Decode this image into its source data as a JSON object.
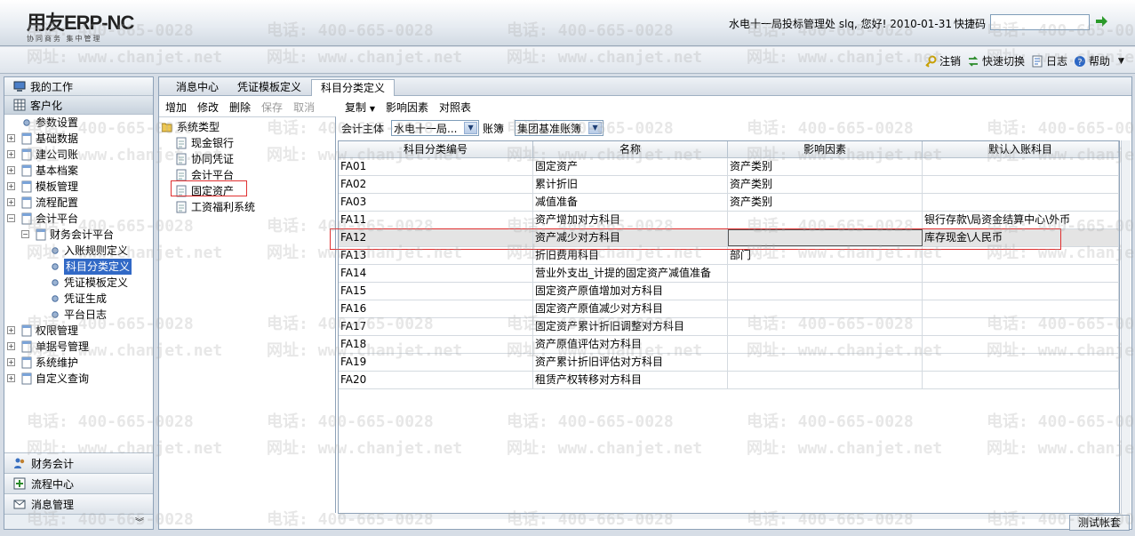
{
  "app": {
    "logo_text": "用友ERP-NC",
    "logo_sub": "协同商务 集中管理",
    "user_info": "水电十一局投标管理处 slq, 您好! 2010-01-31",
    "quick_code_label": "快捷码"
  },
  "toolbar2": {
    "logout": "注销",
    "quick_switch": "快速切换",
    "log": "日志",
    "help": "帮助"
  },
  "leftpanel": {
    "header_work": "我的工作",
    "header_custom": "客户化",
    "tree": [
      {
        "label": "参数设置",
        "level": 0,
        "expander": "none"
      },
      {
        "label": "基础数据",
        "level": 0,
        "expander": "plus"
      },
      {
        "label": "建公司账",
        "level": 0,
        "expander": "plus"
      },
      {
        "label": "基本档案",
        "level": 0,
        "expander": "plus"
      },
      {
        "label": "模板管理",
        "level": 0,
        "expander": "plus"
      },
      {
        "label": "流程配置",
        "level": 0,
        "expander": "plus"
      },
      {
        "label": "会计平台",
        "level": 0,
        "expander": "minus"
      },
      {
        "label": "财务会计平台",
        "level": 1,
        "expander": "minus"
      },
      {
        "label": "入账规则定义",
        "level": 2,
        "expander": "none"
      },
      {
        "label": "科目分类定义",
        "level": 2,
        "expander": "none",
        "selected": true
      },
      {
        "label": "凭证模板定义",
        "level": 2,
        "expander": "none"
      },
      {
        "label": "凭证生成",
        "level": 2,
        "expander": "none"
      },
      {
        "label": "平台日志",
        "level": 2,
        "expander": "none"
      },
      {
        "label": "权限管理",
        "level": 0,
        "expander": "plus"
      },
      {
        "label": "单据号管理",
        "level": 0,
        "expander": "plus"
      },
      {
        "label": "系统维护",
        "level": 0,
        "expander": "plus"
      },
      {
        "label": "自定义查询",
        "level": 0,
        "expander": "plus"
      }
    ],
    "bottom": [
      "财务会计",
      "流程中心",
      "消息管理"
    ]
  },
  "tabs": [
    "消息中心",
    "凭证模板定义",
    "科目分类定义"
  ],
  "left_toolbar": {
    "add": "增加",
    "edit": "修改",
    "delete": "删除",
    "save": "保存",
    "cancel": "取消"
  },
  "right_toolbar": {
    "copy": "复制",
    "factor": "影响因素",
    "mapping": "对照表"
  },
  "systree": {
    "root": "系统类型",
    "items": [
      "现金银行",
      "协同凭证",
      "会计平台",
      "固定资产",
      "工资福利系统"
    ]
  },
  "filter": {
    "entity_label": "会计主体",
    "entity_value": "水电十一局...",
    "book_label": "账簿",
    "book_value": "集团基准账簿"
  },
  "grid": {
    "headers": [
      "科目分类编号",
      "名称",
      "影响因素",
      "默认入账科目"
    ],
    "rows": [
      [
        "FA01",
        "固定资产",
        "资产类别",
        ""
      ],
      [
        "FA02",
        "累计折旧",
        "资产类别",
        ""
      ],
      [
        "FA03",
        "减值准备",
        "资产类别",
        ""
      ],
      [
        "FA11",
        "资产增加对方科目",
        "",
        "银行存款\\局资金结算中心\\外币"
      ],
      [
        "FA12",
        "资产减少对方科目",
        "",
        "库存现金\\人民币"
      ],
      [
        "FA13",
        "折旧费用科目",
        "部门",
        ""
      ],
      [
        "FA14",
        "营业外支出_计提的固定资产减值准备",
        "",
        ""
      ],
      [
        "FA15",
        "固定资产原值增加对方科目",
        "",
        ""
      ],
      [
        "FA16",
        "固定资产原值减少对方科目",
        "",
        ""
      ],
      [
        "FA17",
        "固定资产累计折旧调整对方科目",
        "",
        ""
      ],
      [
        "FA18",
        "资产原值评估对方科目",
        "",
        ""
      ],
      [
        "FA19",
        "资产累计折旧评估对方科目",
        "",
        ""
      ],
      [
        "FA20",
        "租赁产权转移对方科目",
        "",
        ""
      ]
    ]
  },
  "status_label": "测试帐套",
  "watermark": {
    "phone": "电话: 400-665-0028",
    "site": "网址: www.chanjet.net"
  },
  "colors": {
    "selection": "#3169c6",
    "highlight_box": "#e03030",
    "logo_red": "#d02020"
  }
}
